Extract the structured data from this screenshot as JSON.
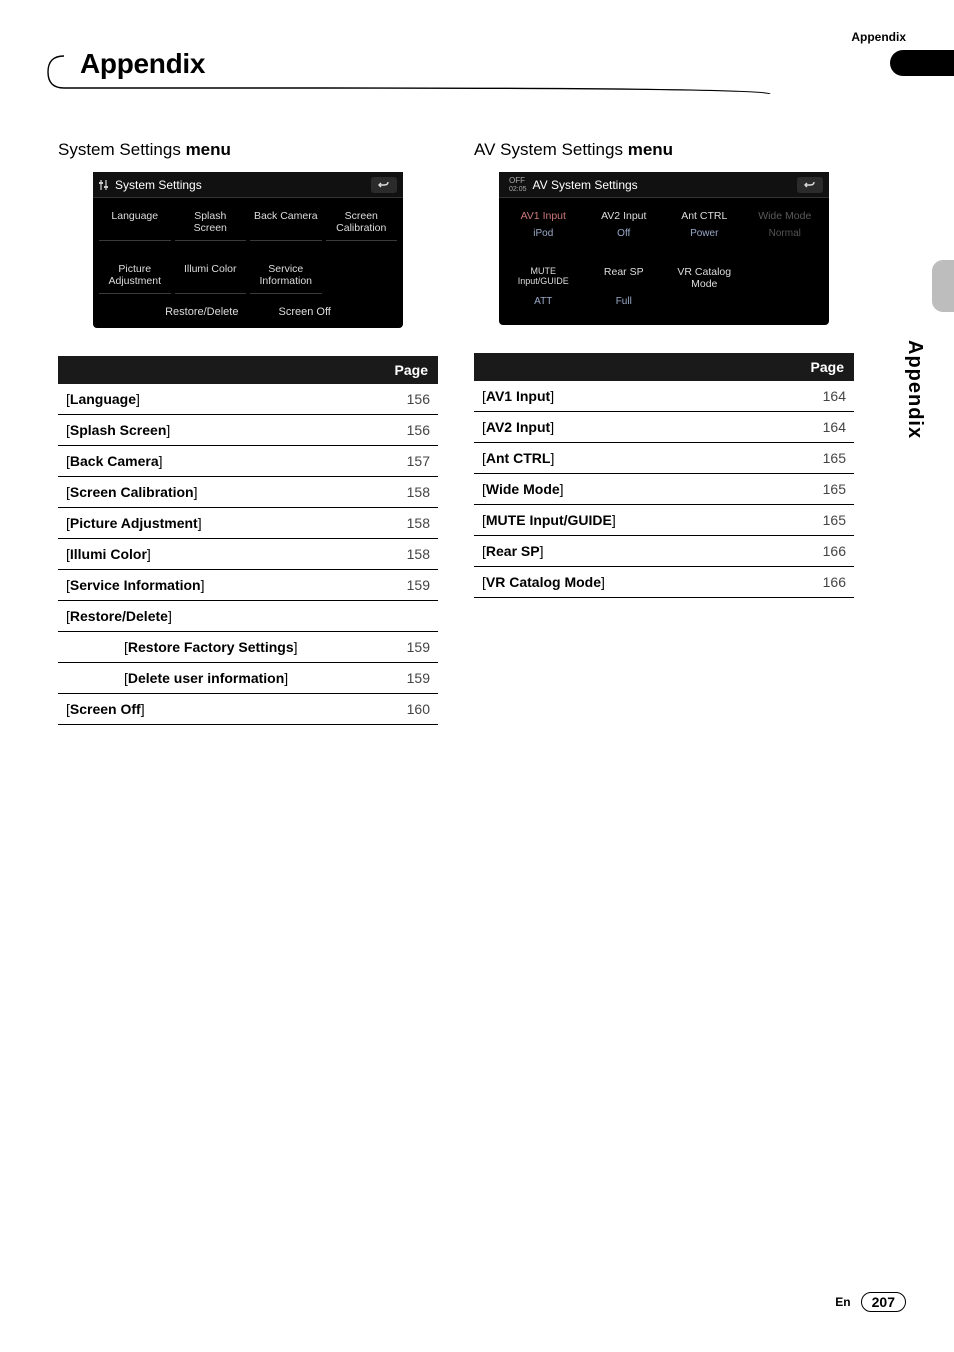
{
  "header": {
    "section_label_small": "Appendix",
    "title": "Appendix",
    "side_vertical": "Appendix"
  },
  "footer": {
    "lang": "En",
    "page": "207"
  },
  "left_menu": {
    "heading_regular": "System Settings ",
    "heading_bold": "menu",
    "panel": {
      "title": "System Settings",
      "row1": [
        "Language",
        "Splash Screen",
        "Back Camera",
        "Screen Calibration"
      ],
      "row2": [
        "Picture Adjustment",
        "Illumi Color",
        "Service Information",
        ""
      ],
      "bottom": [
        "Restore/Delete",
        "Screen Off"
      ]
    },
    "table_header": [
      "",
      "Page"
    ],
    "rows": [
      {
        "label": "Language",
        "page": "156"
      },
      {
        "label": "Splash Screen",
        "page": "156"
      },
      {
        "label": "Back Camera",
        "page": "157"
      },
      {
        "label": "Screen Calibration",
        "page": "158"
      },
      {
        "label": "Picture Adjustment",
        "page": "158"
      },
      {
        "label": "Illumi Color",
        "page": "158"
      },
      {
        "label": "Service Information",
        "page": "159"
      },
      {
        "label": "Restore/Delete",
        "page": ""
      },
      {
        "label": "Restore Factory Settings",
        "page": "159",
        "indent": true
      },
      {
        "label": "Delete user information",
        "page": "159",
        "indent": true
      },
      {
        "label": "Screen Off",
        "page": "160"
      }
    ]
  },
  "right_menu": {
    "heading_regular": "AV System Settings ",
    "heading_bold": "menu",
    "panel": {
      "off_label": "OFF",
      "off_time": "02:05",
      "title": "AV System Settings",
      "row1": [
        "AV1 Input",
        "AV2 Input",
        "Ant CTRL",
        "Wide Mode"
      ],
      "row1sub": [
        "iPod",
        "Off",
        "Power",
        "Normal"
      ],
      "row2": [
        "MUTE Input/GUIDE",
        "Rear SP",
        "VR Catalog Mode",
        ""
      ],
      "row2sub": [
        "ATT",
        "Full",
        "",
        ""
      ]
    },
    "table_header": [
      "",
      "Page"
    ],
    "rows": [
      {
        "label": "AV1 Input",
        "page": "164"
      },
      {
        "label": "AV2 Input",
        "page": "164"
      },
      {
        "label": "Ant CTRL",
        "page": "165"
      },
      {
        "label": "Wide Mode",
        "page": "165"
      },
      {
        "label": "MUTE Input/GUIDE",
        "page": "165"
      },
      {
        "label": "Rear SP",
        "page": "166"
      },
      {
        "label": "VR Catalog Mode",
        "page": "166"
      }
    ]
  }
}
